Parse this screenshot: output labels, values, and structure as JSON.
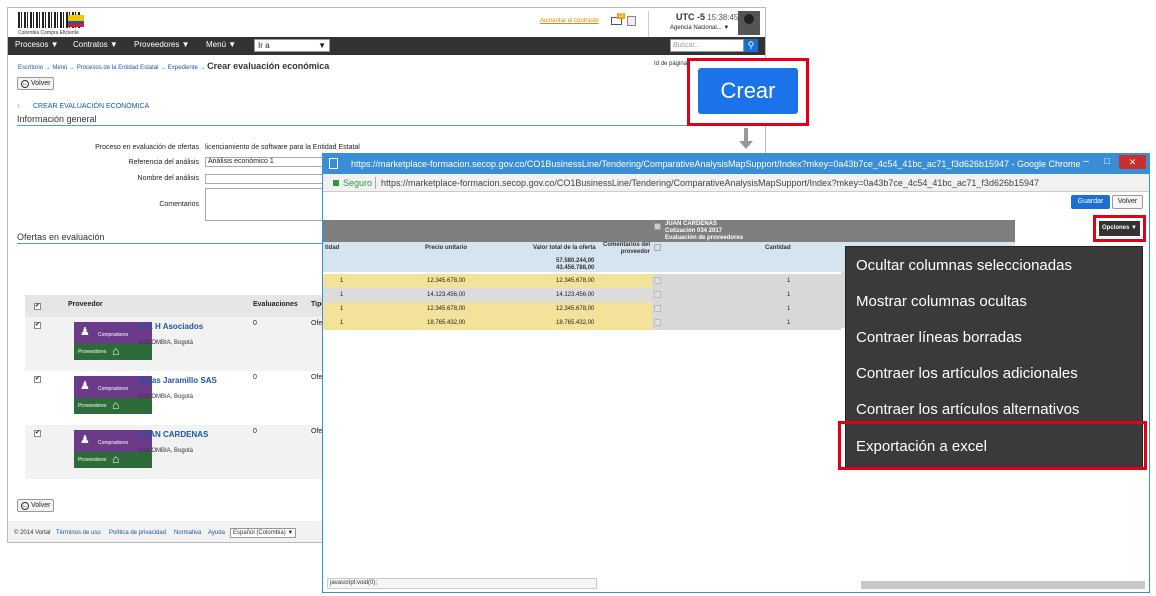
{
  "back": {
    "logo_text": "Colombia Compra Eficiente",
    "top_link": "Aumentar el contraste",
    "mail_badge": "15",
    "utc": "UTC -5",
    "time": "15:38:45",
    "agency": "Agencia Nacional...",
    "nav": [
      "Procesos",
      "Contratos",
      "Proveedores",
      "Menú"
    ],
    "goto": "Ir a",
    "search_placeholder": "Buscar...",
    "breadcrumbs": [
      "Escritorio",
      "Menú",
      "Procesos de la Entidad Estatal",
      "Expediente"
    ],
    "breadcrumb_current": "Crear evaluación económica",
    "page_id": "Id de página",
    "back_button": "Volver",
    "section_title": "CREAR EVALUACIÓN ECONÓMICA",
    "general_info": "Información general",
    "fields": {
      "process_label": "Proceso en evaluación de ofertas",
      "process_value": "licenciamiento de software para la Entidad Estatal",
      "reference_label": "Referencia del análisis",
      "reference_value": "Análisis económico 1",
      "name_label": "Nombre del análisis",
      "comments_label": "Comentarios"
    },
    "offers_title": "Ofertas en evaluación",
    "table_headers": {
      "provider": "Proveedor",
      "evaluations": "Evaluaciones",
      "type": "Tipo"
    },
    "tile": {
      "top": "Compradores",
      "bottom": "Proveedores"
    },
    "offers": [
      {
        "name": "H & H Asociados",
        "location": "COLOMBIA, Bogotá",
        "evals": "0",
        "type": "Ofe"
      },
      {
        "name": "Rojas Jaramillo SAS",
        "location": "COLOMBIA, Bogotá",
        "evals": "0",
        "type": "Ofe"
      },
      {
        "name": "JUAN CARDENAS",
        "location": "COLOMBIA, Bogotá",
        "evals": "0",
        "type": "Ofe"
      }
    ],
    "footer": {
      "copyright": "© 2014 Vortal",
      "links": [
        "Términos de uso",
        "Política de privacidad",
        "Normativa",
        "Ayuda"
      ],
      "language": "Español (Colombia)"
    }
  },
  "crear_label": "Crear",
  "chrome": {
    "title": "https://marketplace-formacion.secop.gov.co/CO1BusinessLine/Tendering/ComparativeAnalysisMapSupport/Index?mkey=0a43b7ce_4c54_41bc_ac71_f3d626b15947 - Google Chrome",
    "secure": "Seguro",
    "url": "https://marketplace-formacion.secop.gov.co/CO1BusinessLine/Tendering/ComparativeAnalysisMapSupport/Index?mkey=0a43b7ce_4c54_41bc_ac71_f3d626b15947",
    "save": "Guardar",
    "back": "Volver",
    "supplier_name": "JUAN CARDENAS",
    "supplier_quote": "Cotización 034 2017",
    "supplier_eval": "Evaluación de proveedores",
    "headers": {
      "qty_left": "tidad",
      "unit_price": "Precio unitario",
      "total": "Valor total de la oferta",
      "comments": "Comentarios del proveedor",
      "qty": "Cantidad"
    },
    "totals": [
      "57.580.244,00",
      "43.456.788,00"
    ],
    "rows": [
      {
        "qty": "1",
        "unit": "12.345.678,00",
        "total": "12.345.678,00",
        "cant": "1"
      },
      {
        "qty": "1",
        "unit": "14.123.456,00",
        "total": "14.123.456,00",
        "cant": "1"
      },
      {
        "qty": "1",
        "unit": "12.345.678,00",
        "total": "12.345.678,00",
        "cant": "1"
      },
      {
        "qty": "1",
        "unit": "18.765.432,00",
        "total": "18.765.432,00",
        "cant": "1"
      }
    ],
    "status": "javascript:void(0);",
    "options": "Opciones",
    "menu": [
      "Ocultar columnas seleccionadas",
      "Mostrar columnas ocultas",
      "Contraer líneas borradas",
      "Contraer los artículos adicionales",
      "Contraer los artículos alternativos",
      "Exportación a excel"
    ]
  }
}
